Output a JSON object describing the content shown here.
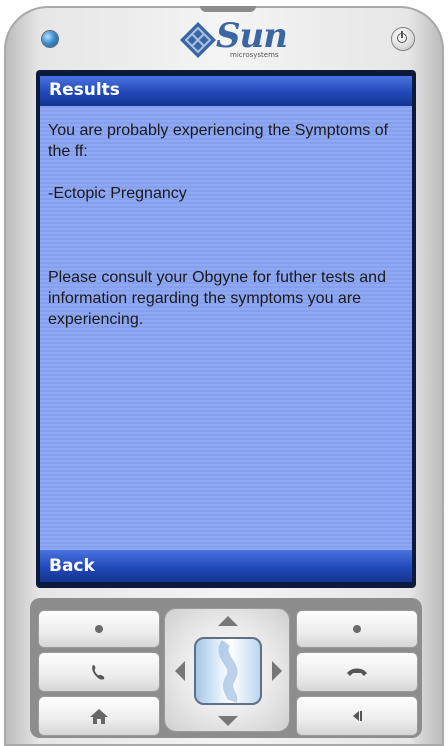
{
  "device": {
    "logo_text": "Sun",
    "logo_subtext": "microsystems"
  },
  "screen": {
    "title": "Results",
    "lines": [
      "You are probably experiencing the Symptoms of the ff:",
      "-Ectopic Pregnancy",
      "Please consult your Obgyne for futher tests and information regarding the symptoms you are experiencing."
    ],
    "softkey_left": "Back"
  },
  "keypad": {
    "icons": [
      "dot-left-top",
      "dot-right-top",
      "call-icon",
      "end-call-icon",
      "home-icon",
      "back-icon",
      "dpad-up-arrow",
      "dpad-down-arrow",
      "dpad-left-arrow",
      "dpad-right-arrow"
    ]
  },
  "colors": {
    "screen_bg": "#8ea8f4",
    "titlebar": "#2148b8",
    "logo": "#3a66a3"
  }
}
